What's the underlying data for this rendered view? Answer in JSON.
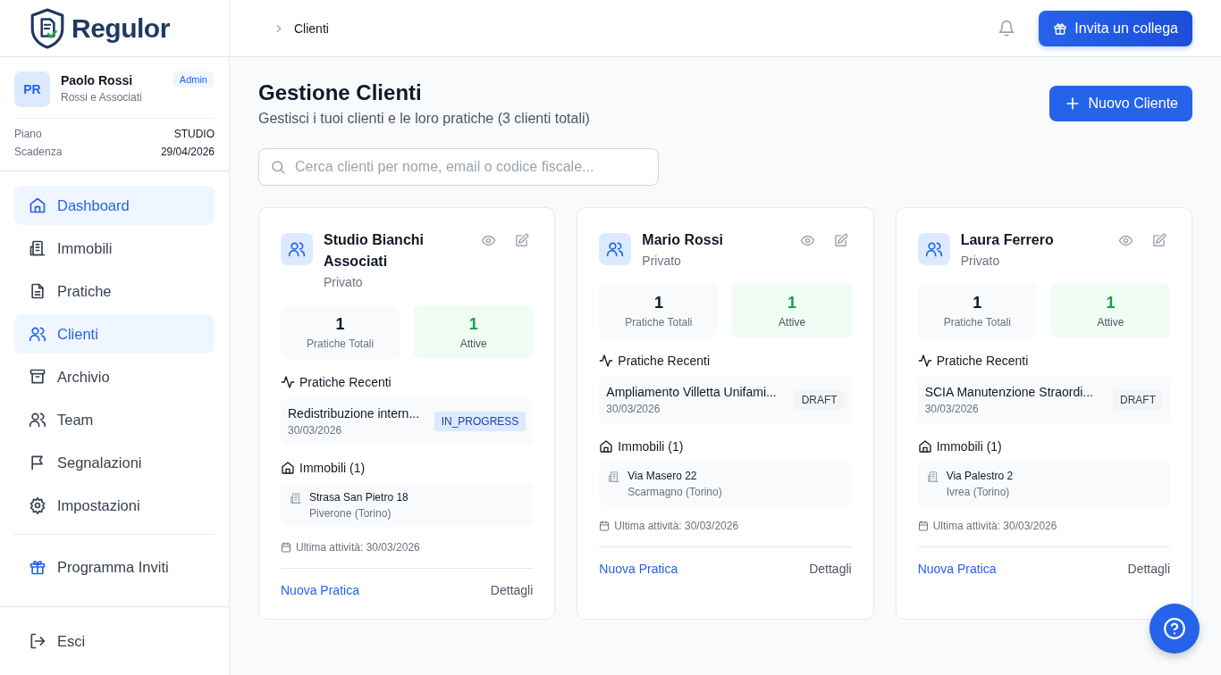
{
  "brand": {
    "name": "Regulor"
  },
  "user": {
    "initials": "PR",
    "name": "Paolo Rossi",
    "role": "Admin",
    "company": "Rossi e Associati"
  },
  "plan": [
    {
      "label": "Piano",
      "value": "STUDIO"
    },
    {
      "label": "Scadenza",
      "value": "29/04/2026"
    }
  ],
  "sidebar": {
    "items": [
      {
        "label": "Dashboard",
        "selected": true
      },
      {
        "label": "Immobili",
        "selected": false
      },
      {
        "label": "Pratiche",
        "selected": false
      },
      {
        "label": "Clienti",
        "selected": true
      },
      {
        "label": "Archivio",
        "selected": false
      },
      {
        "label": "Team",
        "selected": false
      },
      {
        "label": "Segnalazioni",
        "selected": false
      },
      {
        "label": "Impostazioni",
        "selected": false
      }
    ],
    "referral": "Programma Inviti",
    "logout": "Esci"
  },
  "breadcrumb": [
    "Clienti"
  ],
  "invite_button": "Invita un collega",
  "page": {
    "title": "Gestione Clienti",
    "subtitle": "Gestisci i tuoi clienti e le loro pratiche (3 clienti totali)",
    "new_button": "Nuovo Cliente"
  },
  "search": {
    "placeholder": "Cerca clienti per nome, email o codice fiscale..."
  },
  "clients": [
    {
      "name": "Studio Bianchi Associati",
      "type": "Privato",
      "total": "1",
      "total_label": "Pratiche Totali",
      "active": "1",
      "active_label": "Attive",
      "recent_heading": "Pratiche Recenti",
      "recent": [
        {
          "title": "Redistribuzione intern...",
          "date": "30/03/2026",
          "status": "IN_PROGRESS",
          "kind": "progress"
        }
      ],
      "properties_heading": "Immobili (1)",
      "properties": [
        {
          "address": "Strasa San Pietro 18",
          "city": "Piverone (Torino)"
        }
      ],
      "last_activity": "Ultima attività: 30/03/2026",
      "new_link": "Nuova Pratica",
      "details_link": "Dettagli"
    },
    {
      "name": "Mario Rossi",
      "type": "Privato",
      "total": "1",
      "total_label": "Pratiche Totali",
      "active": "1",
      "active_label": "Attive",
      "recent_heading": "Pratiche Recenti",
      "recent": [
        {
          "title": "Ampliamento Villetta Unifami...",
          "date": "30/03/2026",
          "status": "DRAFT",
          "kind": "draft"
        }
      ],
      "properties_heading": "Immobili (1)",
      "properties": [
        {
          "address": "Via Masero 22",
          "city": "Scarmagno (Torino)"
        }
      ],
      "last_activity": "Ultima attività: 30/03/2026",
      "new_link": "Nuova Pratica",
      "details_link": "Dettagli"
    },
    {
      "name": "Laura Ferrero",
      "type": "Privato",
      "total": "1",
      "total_label": "Pratiche Totali",
      "active": "1",
      "active_label": "Attive",
      "recent_heading": "Pratiche Recenti",
      "recent": [
        {
          "title": "SCIA Manutenzione Straordi...",
          "date": "30/03/2026",
          "status": "DRAFT",
          "kind": "draft"
        }
      ],
      "properties_heading": "Immobili (1)",
      "properties": [
        {
          "address": "Via Palestro 2",
          "city": "Ivrea (Torino)"
        }
      ],
      "last_activity": "Ultima attività: 30/03/2026",
      "new_link": "Nuova Pratica",
      "details_link": "Dettagli"
    }
  ]
}
